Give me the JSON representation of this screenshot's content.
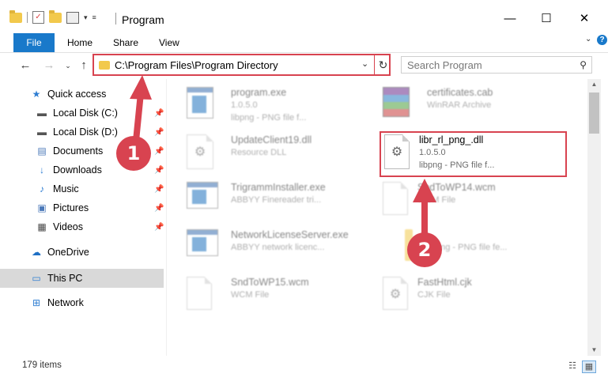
{
  "window": {
    "title": "Program",
    "controls": {
      "minimize": "—",
      "maximize": "☐",
      "close": "✕"
    }
  },
  "ribbon": {
    "tabs": [
      "File",
      "Home",
      "Share",
      "View"
    ],
    "help": "?"
  },
  "navigation": {
    "address": "C:\\Program Files\\Program Directory",
    "search_placeholder": "Search Program"
  },
  "sidebar": {
    "items": [
      {
        "label": "Quick access",
        "icon": "star-icon"
      },
      {
        "label": "Local Disk (C:)",
        "icon": "drive-icon",
        "pinned": true
      },
      {
        "label": "Local Disk (D:)",
        "icon": "drive-icon",
        "pinned": true
      },
      {
        "label": "Documents",
        "icon": "documents-icon",
        "pinned": true
      },
      {
        "label": "Downloads",
        "icon": "download-icon",
        "pinned": true
      },
      {
        "label": "Music",
        "icon": "music-icon",
        "pinned": true
      },
      {
        "label": "Pictures",
        "icon": "pictures-icon",
        "pinned": true
      },
      {
        "label": "Videos",
        "icon": "videos-icon",
        "pinned": true
      },
      {
        "label": "OneDrive",
        "icon": "cloud-icon"
      },
      {
        "label": "This PC",
        "icon": "computer-icon",
        "selected": true
      },
      {
        "label": "Network",
        "icon": "network-icon"
      }
    ]
  },
  "files": [
    {
      "name": "program.exe",
      "line2": "1.0.5.0",
      "line3": "libpng - PNG file f...",
      "icon": "exe-icon",
      "blurred": true
    },
    {
      "name": "certificates.cab",
      "line2": "WinRAR Archive",
      "line3": "",
      "icon": "winrar-icon",
      "blurred": true
    },
    {
      "name": "UpdateClient19.dll",
      "line2": "Resource DLL",
      "line3": "",
      "icon": "dll-icon",
      "blurred": true
    },
    {
      "name": "libr_rl_png_.dll",
      "line2": "1.0.5.0",
      "line3": "libpng - PNG file f...",
      "icon": "dll-gear-icon",
      "blurred": false
    },
    {
      "name": "TrigrammInstaller.exe",
      "line2": "ABBYY Finereader tri...",
      "line3": "",
      "icon": "app-window-icon",
      "blurred": true
    },
    {
      "name": "SndToWP14.wcm",
      "line2": "WCM File",
      "line3": "",
      "icon": "document-icon",
      "blurred": true
    },
    {
      "name": "NetworkLicenseServer.exe",
      "line2": "ABBYY network licenc...",
      "line3": "",
      "icon": "app-window-icon",
      "blurred": true
    },
    {
      "name": "...",
      "line2": "libpng - PNG file fe...",
      "line3": "",
      "icon": "folder-icon",
      "blurred": true
    },
    {
      "name": "SndToWP15.wcm",
      "line2": "WCM File",
      "line3": "",
      "icon": "document-icon",
      "blurred": true
    },
    {
      "name": "FastHtml.cjk",
      "line2": "CJK File",
      "line3": "",
      "icon": "document-icon",
      "blurred": true
    }
  ],
  "annotations": {
    "callout_1": "1",
    "callout_2": "2",
    "highlight_color": "#d84350"
  },
  "status": {
    "item_count": "179 items"
  }
}
